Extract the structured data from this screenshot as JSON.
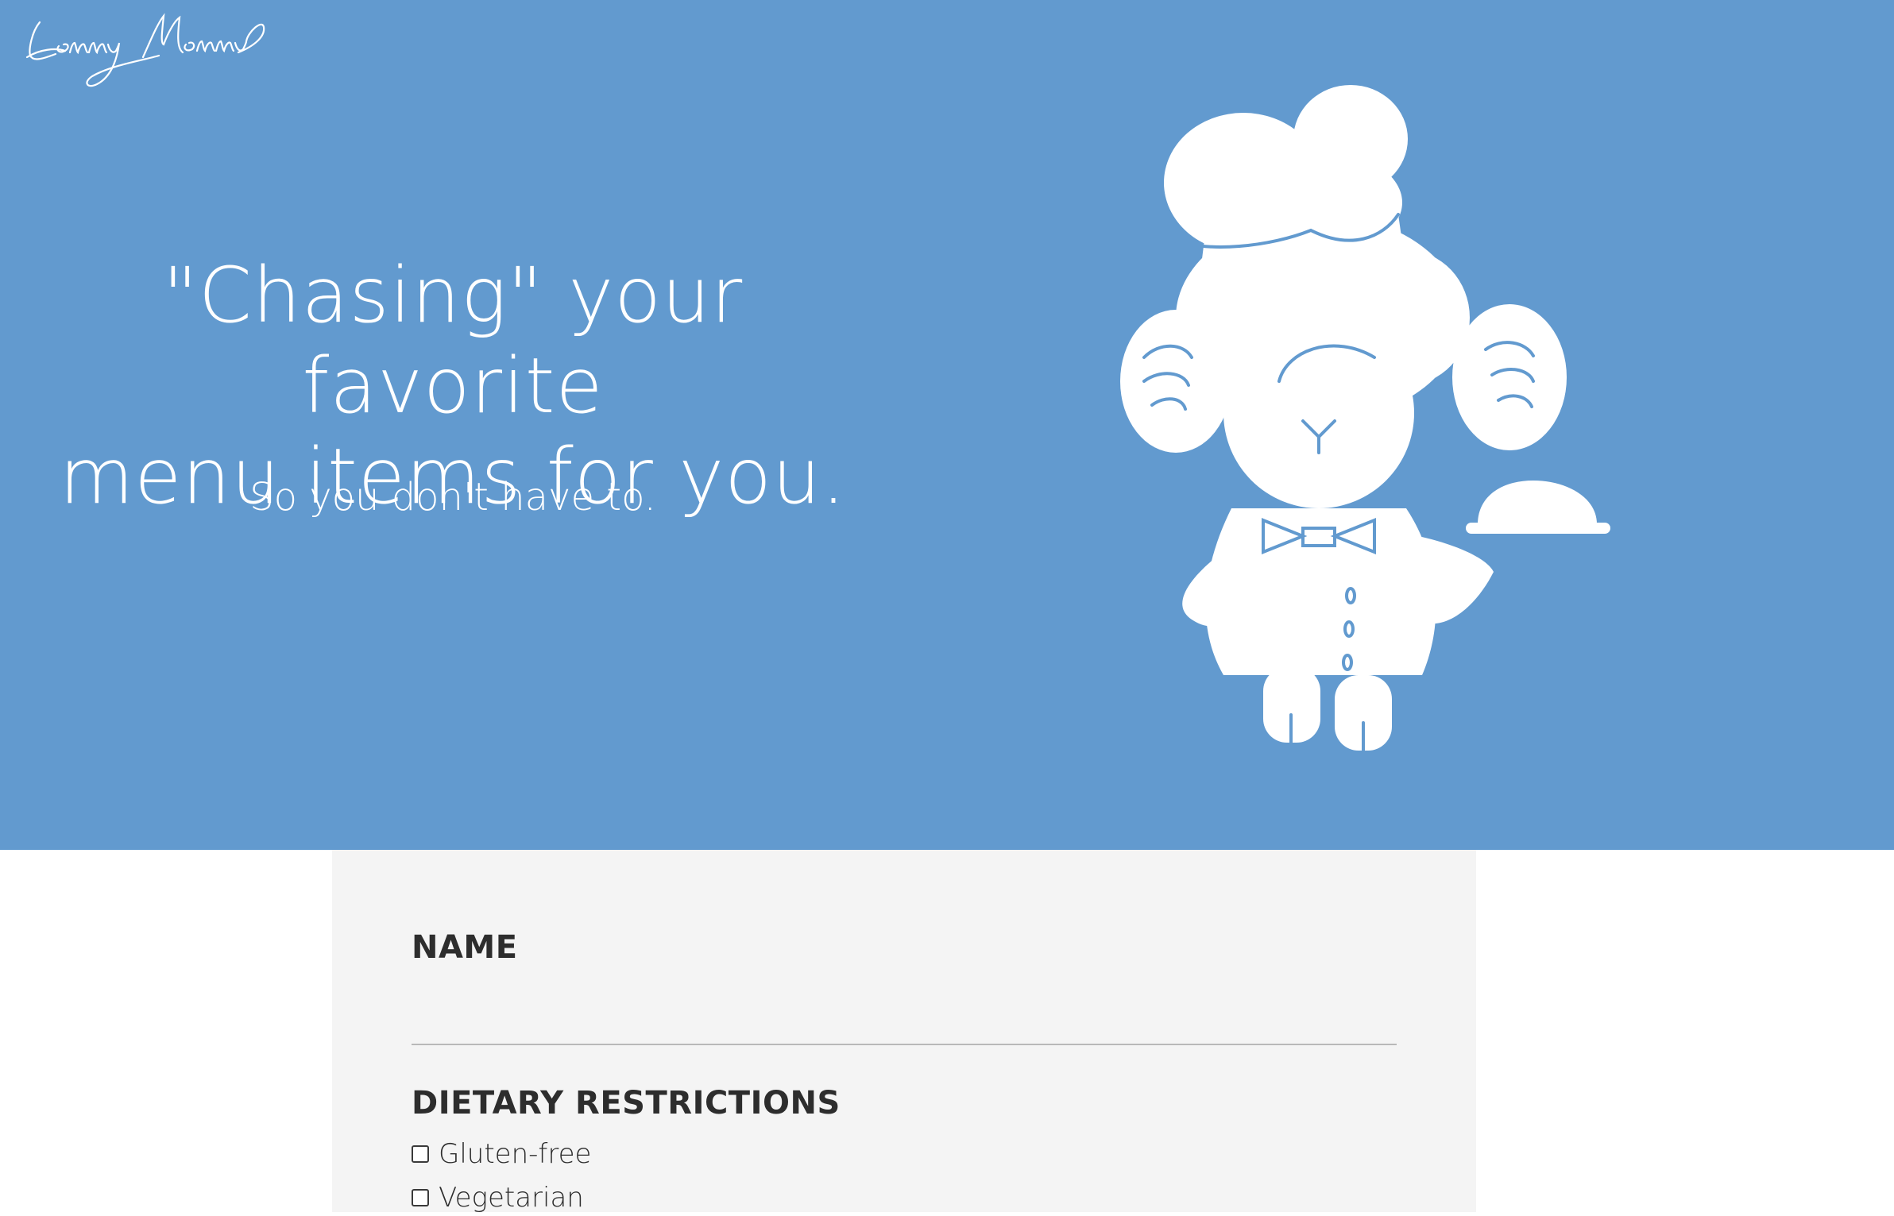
{
  "brand": {
    "logo_text": "Lenny Menny"
  },
  "hero": {
    "headline_line1": "\"Chasing\" your favorite",
    "headline_line2": "menu items for you.",
    "subheadline": "So you don't have to.",
    "background_color": "#629acf",
    "mascot": "chef-ram-mascot"
  },
  "form": {
    "name_label": "NAME",
    "name_value": "",
    "dietary_label": "DIETARY RESTRICTIONS",
    "options": [
      {
        "label": "Gluten-free",
        "checked": false
      },
      {
        "label": "Vegetarian",
        "checked": false
      }
    ]
  }
}
